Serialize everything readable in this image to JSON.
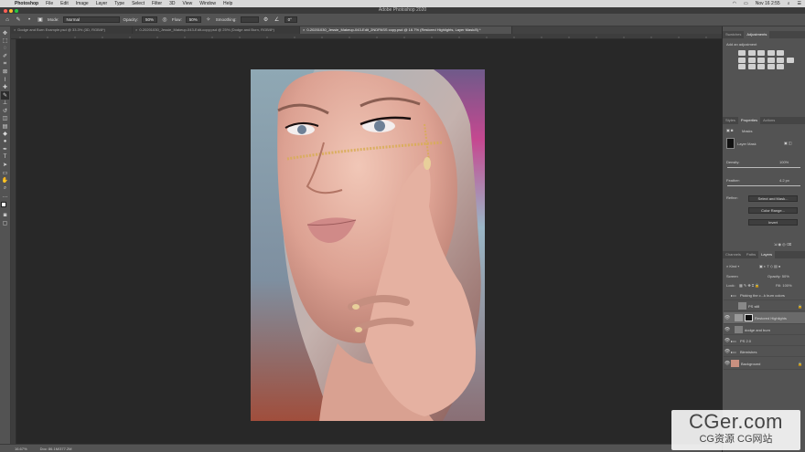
{
  "menubar": {
    "app_name": "Photoshop",
    "items": [
      "File",
      "Edit",
      "Image",
      "Layer",
      "Type",
      "Select",
      "Filter",
      "3D",
      "View",
      "Window",
      "Help"
    ],
    "clock": "Nov 16  2:55"
  },
  "window_title": "Adobe Photoshop 2020",
  "options": {
    "mode_label": "Mode:",
    "mode_value": "Normal",
    "opacity_label": "Opacity:",
    "opacity_value": "50%",
    "flow_label": "Flow:",
    "flow_value": "50%",
    "smoothing_label": "Smoothing:",
    "angle_value": "0°"
  },
  "tabs": [
    {
      "label": "Dodge and Burn Example.psd @ 33.3% (3D, RGB/8*)",
      "active": false
    },
    {
      "label": "0-20201030_Jessie_Makeup-043-Edit-copy.psd @ 25% (Dodge and Burn, RGB/8*)",
      "active": false
    },
    {
      "label": "0-20201030_Jessie_Makeup-043-Edit_2NDPASS copy.psd @ 16.7% (Restored Highlights, Layer Mask/8) *",
      "active": true
    }
  ],
  "status": {
    "zoom": "16.67%",
    "doc": "Doc: 86.1M/377.2M"
  },
  "panels": {
    "top_tabs": [
      "Swatches",
      "Adjustments"
    ],
    "add_adjustment": "Add an adjustment",
    "mid_tabs": [
      "Styles",
      "Properties",
      "Actions"
    ],
    "masks_label": "Masks",
    "layer_mask_label": "Layer Mask",
    "density_label": "Density:",
    "density_value": "100%",
    "feather_label": "Feather:",
    "feather_value": "4.2 px",
    "refine_label": "Refine:",
    "select_mask_btn": "Select and Mask...",
    "color_range_btn": "Color Range...",
    "invert_btn": "Invert",
    "layers_tabs": [
      "Channels",
      "Paths",
      "Layers"
    ],
    "kind_label": "Kind",
    "blend_mode": "Screen",
    "layer_opacity_label": "Opacity:",
    "layer_opacity_value": "50%",
    "lock_label": "Lock:",
    "fill_label": "Fill:",
    "fill_value": "100%",
    "layers": [
      {
        "name": "Picking the c...k burn colors",
        "type": "group",
        "selected": false
      },
      {
        "name": "PS still",
        "type": "layer",
        "selected": false
      },
      {
        "name": "Restored Highlights",
        "type": "mask",
        "selected": true
      },
      {
        "name": "dodge and burn",
        "type": "layer",
        "selected": false
      },
      {
        "name": "PS 2.0",
        "type": "group",
        "selected": false
      },
      {
        "name": "Blemishes",
        "type": "group",
        "selected": false
      },
      {
        "name": "Background",
        "type": "photo",
        "selected": false
      }
    ]
  },
  "watermark": {
    "line1": "CGer.com",
    "line2": "CG资源 CG网站"
  }
}
